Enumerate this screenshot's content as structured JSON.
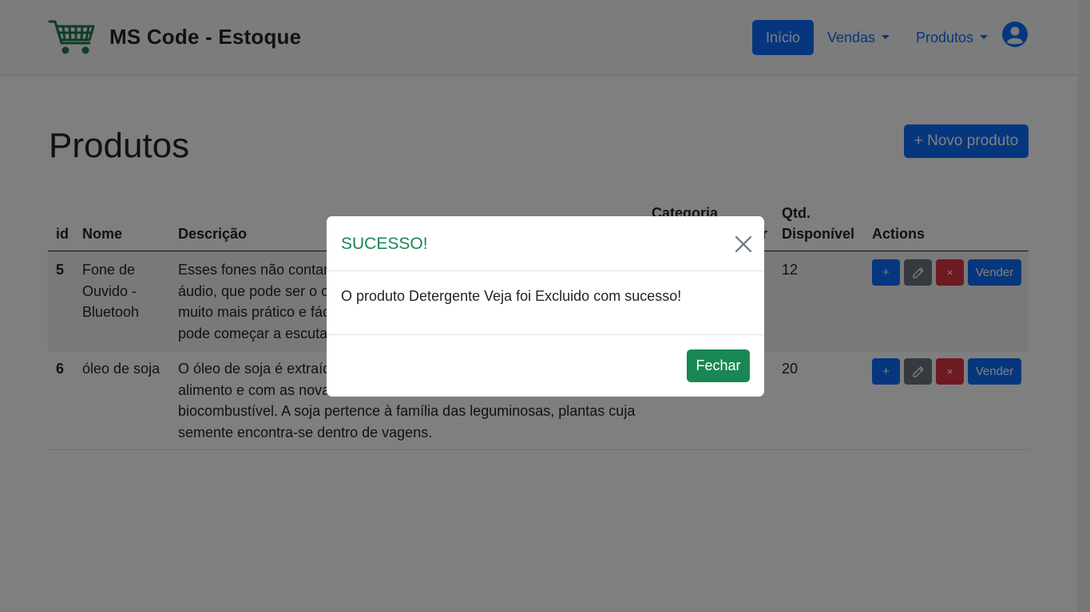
{
  "navbar": {
    "brand": "MS Code - Estoque",
    "logo_icon": "shopping-cart-icon",
    "links": {
      "inicio": "Início",
      "vendas": "Vendas",
      "produtos": "Produtos"
    },
    "user_icon": "user-circle-icon"
  },
  "page": {
    "title": "Produtos",
    "new_button": "+ Novo produto"
  },
  "table": {
    "headers": {
      "id": "id",
      "nome": "Nome",
      "descricao": "Descrição",
      "categoria_line1": "Categoria",
      "categoria_fragment": "r",
      "qtd_line1": "Qtd.",
      "qtd_line2": "Disponível",
      "actions": "Actions"
    },
    "rows": [
      {
        "id": "5",
        "nome_lines": [
          "Fone de",
          "Ouvido -",
          "Bluetooh"
        ],
        "descricao_lines": [
          "Esses fones não contam",
          "áudio, que pode ser o ce",
          "muito mais prático e fác",
          "pode começar a escutar"
        ],
        "qtd": "12",
        "actions": {
          "add": "+",
          "edit_icon": "pencil-icon",
          "delete": "×",
          "sell": "Vender"
        }
      },
      {
        "id": "6",
        "nome_lines": [
          "óleo de soja"
        ],
        "descricao_lines": [
          "O óleo de soja é extraíd",
          "alimento e com as novas",
          "biocombustível. A soja pertence à família das leguminosas, plantas cuja",
          "semente encontra-se dentro de vagens."
        ],
        "qtd": "20",
        "actions": {
          "add": "+",
          "edit_icon": "pencil-icon",
          "delete": "×",
          "sell": "Vender"
        }
      }
    ]
  },
  "modal": {
    "title": "SUCESSO!",
    "close_icon": "close-icon",
    "message": "O produto Detergente Veja foi Excluido com sucesso!",
    "button": "Fechar"
  },
  "colors": {
    "primary": "#0d6efd",
    "secondary": "#6c757d",
    "danger": "#dc3545",
    "success": "#198754",
    "logo": "#1e7a4f"
  }
}
